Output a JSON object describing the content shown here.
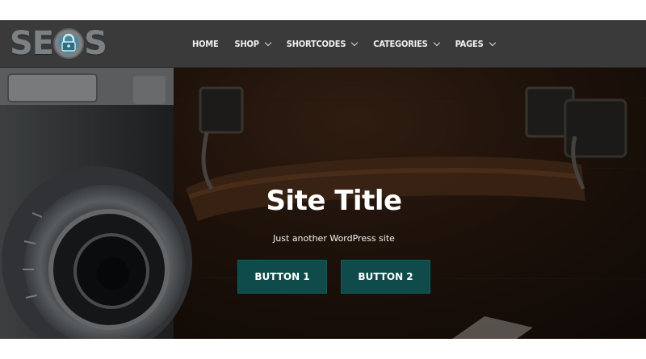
{
  "logo": {
    "text_left": "SE",
    "text_right": "S"
  },
  "nav": {
    "items": [
      {
        "label": "HOME",
        "has_dropdown": false
      },
      {
        "label": "SHOP",
        "has_dropdown": true
      },
      {
        "label": "SHORTCODES",
        "has_dropdown": true
      },
      {
        "label": "CATEGORIES",
        "has_dropdown": true
      },
      {
        "label": "PAGES",
        "has_dropdown": true
      }
    ]
  },
  "hero": {
    "title": "Site Title",
    "tagline": "Just another WordPress site",
    "button1": "BUTTON 1",
    "button2": "BUTTON 2"
  },
  "colors": {
    "navbar": "#3a3a3a",
    "button": "#0f4b4b",
    "logo": "#7c8184"
  }
}
